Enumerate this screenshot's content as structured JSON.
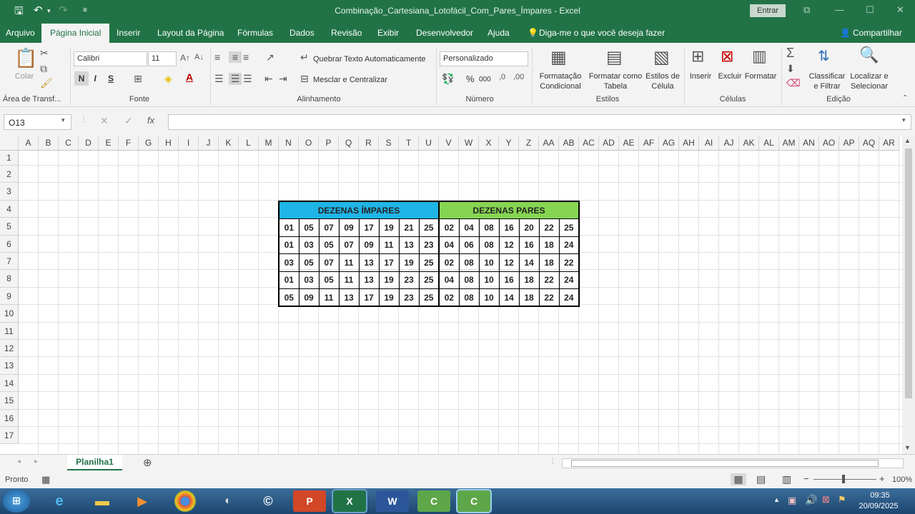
{
  "window": {
    "title": "Combinação_Cartesiana_Lotofácil_Com_Pares_Ímpares  -  Excel",
    "signin": "Entrar"
  },
  "tabs": [
    "Arquivo",
    "Página Inicial",
    "Inserir",
    "Layout da Página",
    "Fórmulas",
    "Dados",
    "Revisão",
    "Exibir",
    "Desenvolvedor",
    "Ajuda"
  ],
  "tell_me": "Diga-me o que você deseja fazer",
  "share": "Compartilhar",
  "ribbon": {
    "clipboard": {
      "paste": "Colar",
      "group": "Área de Transf..."
    },
    "font": {
      "name": "Calibri",
      "size": "11",
      "bold": "N",
      "italic": "I",
      "underline": "S",
      "group": "Fonte"
    },
    "alignment": {
      "wrap": "Quebrar Texto Automaticamente",
      "merge": "Mesclar e Centralizar",
      "group": "Alinhamento"
    },
    "number": {
      "format": "Personalizado",
      "percent": "%",
      "thousands": "000",
      "group": "Número"
    },
    "styles": {
      "conditional": [
        "Formatação",
        "Condicional"
      ],
      "as_table": [
        "Formatar como",
        "Tabela"
      ],
      "cell_styles": [
        "Estilos de",
        "Célula"
      ],
      "group": "Estilos"
    },
    "cells": {
      "insert": "Inserir",
      "delete": "Excluir",
      "format": "Formatar",
      "group": "Células"
    },
    "editing": {
      "sort": [
        "Classificar",
        "e Filtrar"
      ],
      "find": [
        "Localizar e",
        "Selecionar"
      ],
      "group": "Edição"
    }
  },
  "formula_bar": {
    "name_box": "O13",
    "fx": "fx",
    "content": ""
  },
  "columns": [
    "A",
    "B",
    "C",
    "D",
    "E",
    "F",
    "G",
    "H",
    "I",
    "J",
    "K",
    "L",
    "M",
    "N",
    "O",
    "P",
    "Q",
    "R",
    "S",
    "T",
    "U",
    "V",
    "W",
    "X",
    "Y",
    "Z",
    "AA",
    "AB",
    "AC",
    "AD",
    "AE",
    "AF",
    "AG",
    "AH",
    "AI",
    "AJ",
    "AK",
    "AL",
    "AM",
    "AN",
    "AO",
    "AP",
    "AQ",
    "AR"
  ],
  "rows": [
    "1",
    "2",
    "3",
    "4",
    "5",
    "6",
    "7",
    "8",
    "9",
    "10",
    "11",
    "12",
    "13",
    "14",
    "15",
    "16",
    "17"
  ],
  "table": {
    "header_odd": "DEZENAS ÍMPARES",
    "header_even": "DEZENAS PARES",
    "odd_color": "#1fb5e6",
    "even_color": "#86d552",
    "rows": [
      {
        "odd": [
          "01",
          "05",
          "07",
          "09",
          "17",
          "19",
          "21",
          "25"
        ],
        "even": [
          "02",
          "04",
          "08",
          "16",
          "20",
          "22",
          "25"
        ]
      },
      {
        "odd": [
          "01",
          "03",
          "05",
          "07",
          "09",
          "11",
          "13",
          "23"
        ],
        "even": [
          "04",
          "06",
          "08",
          "12",
          "16",
          "18",
          "24"
        ]
      },
      {
        "odd": [
          "03",
          "05",
          "07",
          "11",
          "13",
          "17",
          "19",
          "25"
        ],
        "even": [
          "02",
          "08",
          "10",
          "12",
          "14",
          "18",
          "22"
        ]
      },
      {
        "odd": [
          "01",
          "03",
          "05",
          "11",
          "13",
          "19",
          "23",
          "25"
        ],
        "even": [
          "04",
          "08",
          "10",
          "16",
          "18",
          "22",
          "24"
        ]
      },
      {
        "odd": [
          "05",
          "09",
          "11",
          "13",
          "17",
          "19",
          "23",
          "25"
        ],
        "even": [
          "02",
          "08",
          "10",
          "14",
          "18",
          "22",
          "24"
        ]
      }
    ]
  },
  "sheet_tab": "Planilha1",
  "status": {
    "ready": "Pronto",
    "zoom": "100%"
  },
  "clock": {
    "time": "09:35",
    "date": "20/09/2025"
  }
}
